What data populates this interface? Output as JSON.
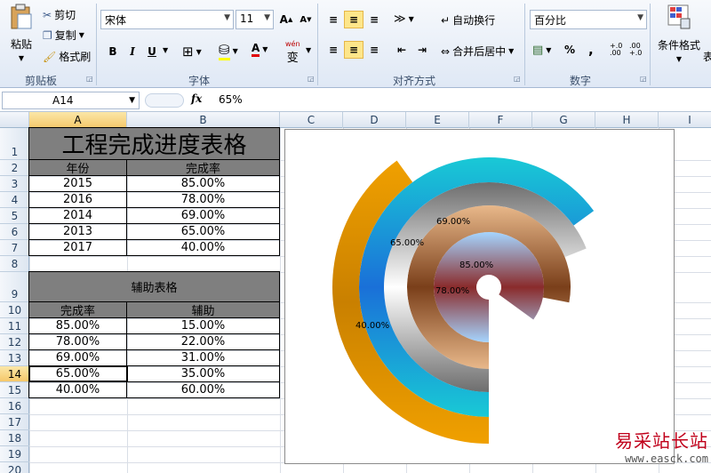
{
  "ribbon": {
    "clipboard": {
      "paste": "粘贴",
      "cut": "剪切",
      "copy": "复制",
      "format_painter": "格式刷",
      "group": "剪贴板"
    },
    "font": {
      "name": "宋体",
      "size": "11",
      "group": "字体",
      "bold": "B",
      "italic": "I",
      "underline": "U",
      "grow": "A",
      "shrink": "A",
      "pinyin": "wén",
      "pinyin_char": "变"
    },
    "alignment": {
      "wrap": "自动换行",
      "merge": "合并后居中",
      "group": "对齐方式"
    },
    "number": {
      "format": "百分比",
      "percent": "%",
      "comma": ",",
      "inc_decimal": "+.0 .00",
      "dec_decimal": ".00 +.0",
      "group": "数字"
    },
    "styles": {
      "conditional": "条件格式",
      "table_label_fragment": "表"
    }
  },
  "formula_bar": {
    "name_box": "A14",
    "fx": "fx",
    "value": "65%"
  },
  "columns": [
    "A",
    "B",
    "C",
    "D",
    "E",
    "F",
    "G",
    "H",
    "I"
  ],
  "selected_column": "A",
  "rows": [
    "1",
    "2",
    "3",
    "4",
    "5",
    "6",
    "7",
    "8",
    "9",
    "10",
    "11",
    "12",
    "13",
    "14",
    "15",
    "16",
    "17",
    "18",
    "19",
    "20"
  ],
  "selected_row": "14",
  "table1": {
    "title": "工程完成进度表格",
    "headers": [
      "年份",
      "完成率"
    ],
    "rows": [
      [
        "2015",
        "85.00%"
      ],
      [
        "2016",
        "78.00%"
      ],
      [
        "2014",
        "69.00%"
      ],
      [
        "2013",
        "65.00%"
      ],
      [
        "2017",
        "40.00%"
      ]
    ]
  },
  "table2": {
    "title": "辅助表格",
    "headers": [
      "完成率",
      "辅助"
    ],
    "rows": [
      [
        "85.00%",
        "15.00%"
      ],
      [
        "78.00%",
        "22.00%"
      ],
      [
        "69.00%",
        "31.00%"
      ],
      [
        "65.00%",
        "35.00%"
      ],
      [
        "40.00%",
        "60.00%"
      ]
    ]
  },
  "chart_data": {
    "type": "doughnut",
    "series": [
      {
        "value": 0.85,
        "label": "85.00%",
        "color_top": "#a5d5ff",
        "color_bottom": "#8a2b2b"
      },
      {
        "value": 0.78,
        "label": "78.00%",
        "color_top": "#e8b88a",
        "color_bottom": "#7a3f1a"
      },
      {
        "value": 0.69,
        "label": "69.00%",
        "color_top": "#6e6e6e",
        "color_bottom": "#ffffff"
      },
      {
        "value": 0.65,
        "label": "65.00%",
        "color_top": "#19c9d6",
        "color_bottom": "#1a70d8"
      },
      {
        "value": 0.4,
        "label": "40.00%",
        "color_top": "#f0a000",
        "color_bottom": "#c98000"
      }
    ]
  },
  "watermark": {
    "cn": "易采站长站",
    "en": "www.easck.com"
  }
}
